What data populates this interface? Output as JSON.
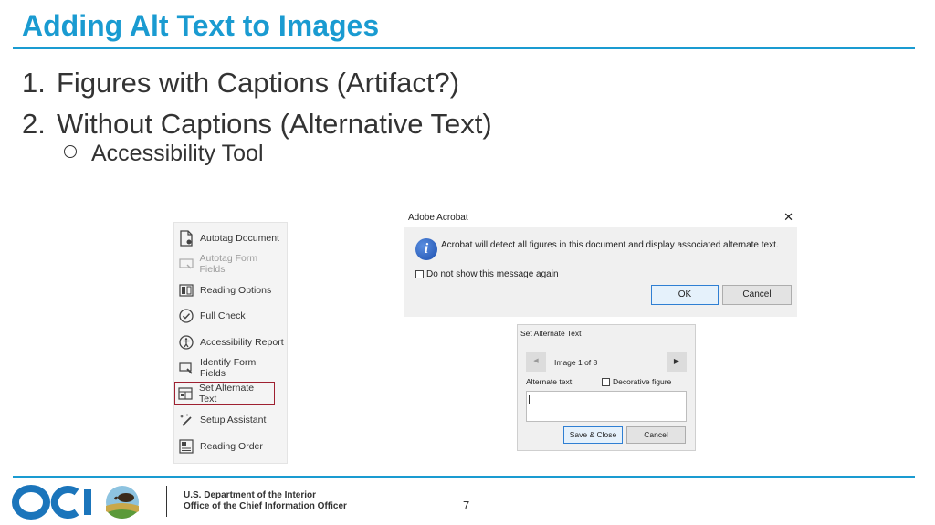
{
  "slide": {
    "title": "Adding Alt Text to Images",
    "list": [
      {
        "num": "1.",
        "text": "Figures with Captions (Artifact?)"
      },
      {
        "num": "2.",
        "text": "Without Captions (Alternative Text)"
      }
    ],
    "sub_item": "Accessibility Tool",
    "page_number": "7"
  },
  "tool_panel": {
    "items": [
      {
        "label": "Autotag Document",
        "icon": "tag-document-icon",
        "disabled": false
      },
      {
        "label": "Autotag Form Fields",
        "icon": "form-fields-icon",
        "disabled": true
      },
      {
        "label": "Reading Options",
        "icon": "reading-options-icon",
        "disabled": false
      },
      {
        "label": "Full Check",
        "icon": "checkmark-circle-icon",
        "disabled": false
      },
      {
        "label": "Accessibility Report",
        "icon": "accessibility-person-icon",
        "disabled": false
      },
      {
        "label": "Identify Form Fields",
        "icon": "identify-fields-icon",
        "disabled": false
      },
      {
        "label": "Set Alternate Text",
        "icon": "alt-text-icon",
        "disabled": false,
        "selected": true
      },
      {
        "label": "Setup Assistant",
        "icon": "magic-wand-icon",
        "disabled": false
      },
      {
        "label": "Reading Order",
        "icon": "reading-order-icon",
        "disabled": false
      }
    ],
    "selected_border_color": "#9e2030"
  },
  "acrobat_dialog": {
    "title": "Adobe Acrobat",
    "message": "Acrobat will detect all figures in this document and display associated alternate text.",
    "checkbox_label": "Do not show this message again",
    "ok_label": "OK",
    "cancel_label": "Cancel"
  },
  "alt_text_dialog": {
    "title": "Set Alternate Text",
    "image_counter": "Image 1 of 8",
    "alt_text_label": "Alternate text:",
    "decorative_label": "Decorative figure",
    "alt_text_value": "",
    "save_label": "Save & Close",
    "cancel_label": "Cancel"
  },
  "footer": {
    "line1": "U.S. Department of the Interior",
    "line2": "Office of the Chief Information Officer"
  },
  "colors": {
    "accent": "#1a9bd1",
    "text": "#333333"
  }
}
